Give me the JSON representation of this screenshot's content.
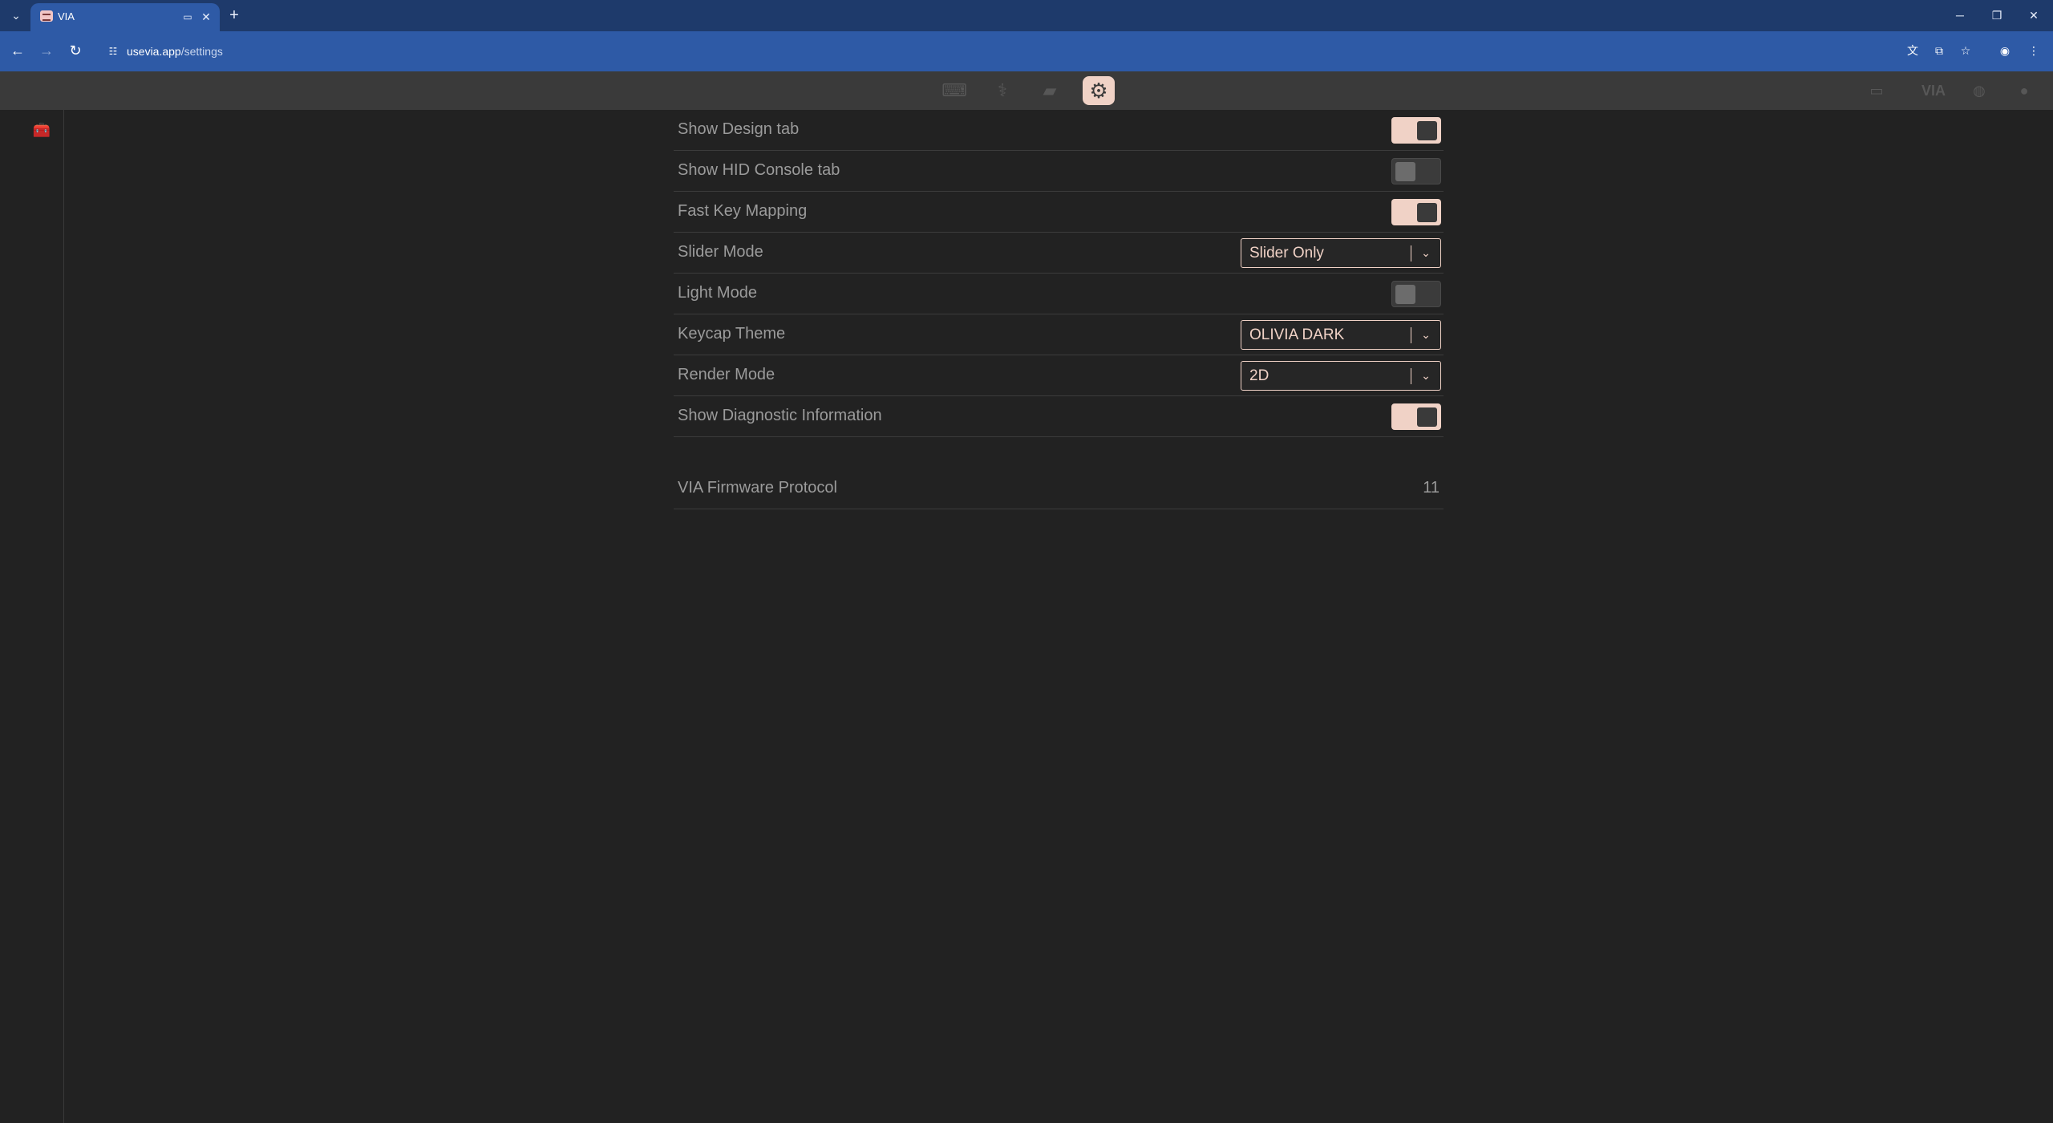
{
  "browser": {
    "tab_title": "VIA",
    "url_host": "usevia.app",
    "url_path": "/settings"
  },
  "app": {
    "accent_color": "#f0d2c6",
    "menu_icons": [
      "keyboard-icon",
      "stethoscope-icon",
      "design-icon",
      "gear-icon"
    ],
    "right_icons": [
      "keycap-icon",
      "via-logo",
      "discord-icon",
      "github-icon"
    ],
    "right_logo_text": "VIA",
    "sidebar_icon": "toolbox-icon"
  },
  "settings": {
    "rows": [
      {
        "label": "Show Design tab",
        "type": "toggle",
        "on": true
      },
      {
        "label": "Show HID Console tab",
        "type": "toggle",
        "on": false
      },
      {
        "label": "Fast Key Mapping",
        "type": "toggle",
        "on": true
      },
      {
        "label": "Slider Mode",
        "type": "select",
        "value": "Slider Only"
      },
      {
        "label": "Light Mode",
        "type": "toggle",
        "on": false
      },
      {
        "label": "Keycap Theme",
        "type": "select",
        "value": "OLIVIA DARK"
      },
      {
        "label": "Render Mode",
        "type": "select",
        "value": "2D"
      },
      {
        "label": "Show Diagnostic Information",
        "type": "toggle",
        "on": true
      }
    ],
    "firmware": {
      "label": "VIA Firmware Protocol",
      "value": "11"
    }
  }
}
